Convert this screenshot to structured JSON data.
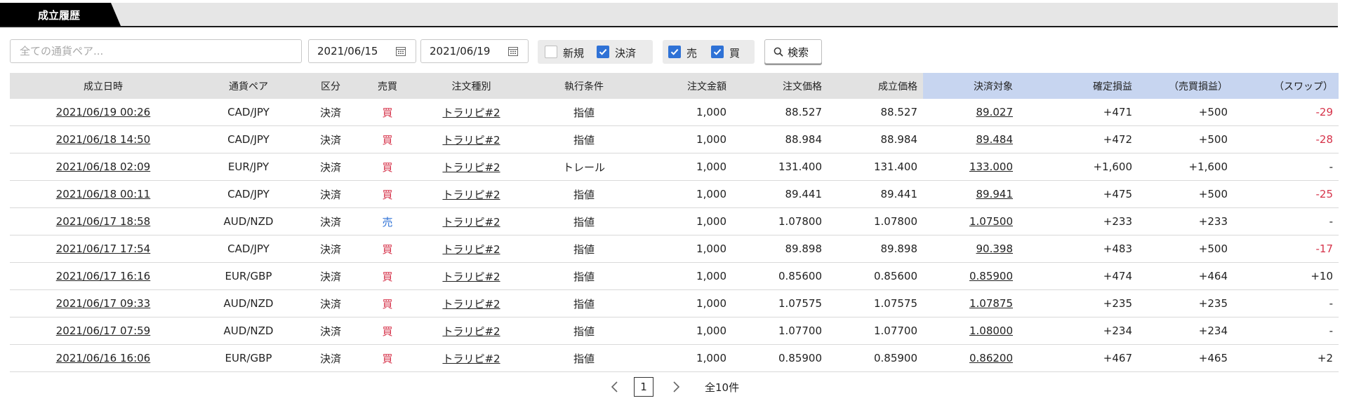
{
  "tab": {
    "label": "成立履歴"
  },
  "filters": {
    "pair_placeholder": "全ての通貨ペア...",
    "date_from": "2021/06/15",
    "date_to": "2021/06/19",
    "new_label": "新規",
    "new_checked": false,
    "settle_label": "決済",
    "settle_checked": true,
    "sell_label": "売",
    "sell_checked": true,
    "buy_label": "買",
    "buy_checked": true,
    "search_label": "検索"
  },
  "table": {
    "headers": [
      "成立日時",
      "通貨ペア",
      "区分",
      "売買",
      "注文種別",
      "執行条件",
      "注文金額",
      "注文価格",
      "成立価格",
      "決済対象",
      "確定損益",
      "（売買損益）",
      "（スワップ）"
    ],
    "rows": [
      {
        "datetime": "2021/06/19 00:26",
        "pair": "CAD/JPY",
        "kind": "決済",
        "side": "買",
        "order_type": "トラリピ#2",
        "condition": "指値",
        "amount": "1,000",
        "order_price": "88.527",
        "fill_price": "88.527",
        "target": "89.027",
        "pnl": "+471",
        "trade_pnl": "+500",
        "swap": "-29"
      },
      {
        "datetime": "2021/06/18 14:50",
        "pair": "CAD/JPY",
        "kind": "決済",
        "side": "買",
        "order_type": "トラリピ#2",
        "condition": "指値",
        "amount": "1,000",
        "order_price": "88.984",
        "fill_price": "88.984",
        "target": "89.484",
        "pnl": "+472",
        "trade_pnl": "+500",
        "swap": "-28"
      },
      {
        "datetime": "2021/06/18 02:09",
        "pair": "EUR/JPY",
        "kind": "決済",
        "side": "買",
        "order_type": "トラリピ#2",
        "condition": "トレール",
        "amount": "1,000",
        "order_price": "131.400",
        "fill_price": "131.400",
        "target": "133.000",
        "pnl": "+1,600",
        "trade_pnl": "+1,600",
        "swap": "-"
      },
      {
        "datetime": "2021/06/18 00:11",
        "pair": "CAD/JPY",
        "kind": "決済",
        "side": "買",
        "order_type": "トラリピ#2",
        "condition": "指値",
        "amount": "1,000",
        "order_price": "89.441",
        "fill_price": "89.441",
        "target": "89.941",
        "pnl": "+475",
        "trade_pnl": "+500",
        "swap": "-25"
      },
      {
        "datetime": "2021/06/17 18:58",
        "pair": "AUD/NZD",
        "kind": "決済",
        "side": "売",
        "order_type": "トラリピ#2",
        "condition": "指値",
        "amount": "1,000",
        "order_price": "1.07800",
        "fill_price": "1.07800",
        "target": "1.07500",
        "pnl": "+233",
        "trade_pnl": "+233",
        "swap": "-"
      },
      {
        "datetime": "2021/06/17 17:54",
        "pair": "CAD/JPY",
        "kind": "決済",
        "side": "買",
        "order_type": "トラリピ#2",
        "condition": "指値",
        "amount": "1,000",
        "order_price": "89.898",
        "fill_price": "89.898",
        "target": "90.398",
        "pnl": "+483",
        "trade_pnl": "+500",
        "swap": "-17"
      },
      {
        "datetime": "2021/06/17 16:16",
        "pair": "EUR/GBP",
        "kind": "決済",
        "side": "買",
        "order_type": "トラリピ#2",
        "condition": "指値",
        "amount": "1,000",
        "order_price": "0.85600",
        "fill_price": "0.85600",
        "target": "0.85900",
        "pnl": "+474",
        "trade_pnl": "+464",
        "swap": "+10"
      },
      {
        "datetime": "2021/06/17 09:33",
        "pair": "AUD/NZD",
        "kind": "決済",
        "side": "買",
        "order_type": "トラリピ#2",
        "condition": "指値",
        "amount": "1,000",
        "order_price": "1.07575",
        "fill_price": "1.07575",
        "target": "1.07875",
        "pnl": "+235",
        "trade_pnl": "+235",
        "swap": "-"
      },
      {
        "datetime": "2021/06/17 07:59",
        "pair": "AUD/NZD",
        "kind": "決済",
        "side": "買",
        "order_type": "トラリピ#2",
        "condition": "指値",
        "amount": "1,000",
        "order_price": "1.07700",
        "fill_price": "1.07700",
        "target": "1.08000",
        "pnl": "+234",
        "trade_pnl": "+234",
        "swap": "-"
      },
      {
        "datetime": "2021/06/16 16:06",
        "pair": "EUR/GBP",
        "kind": "決済",
        "side": "買",
        "order_type": "トラリピ#2",
        "condition": "指値",
        "amount": "1,000",
        "order_price": "0.85900",
        "fill_price": "0.85900",
        "target": "0.86200",
        "pnl": "+467",
        "trade_pnl": "+465",
        "swap": "+2"
      }
    ]
  },
  "pager": {
    "current": "1",
    "total": "全10件"
  },
  "colors": {
    "buy": "#d6334a",
    "sell": "#2f72d6",
    "check": "#2f72d6",
    "highlight_header": "#c7d5f0"
  }
}
